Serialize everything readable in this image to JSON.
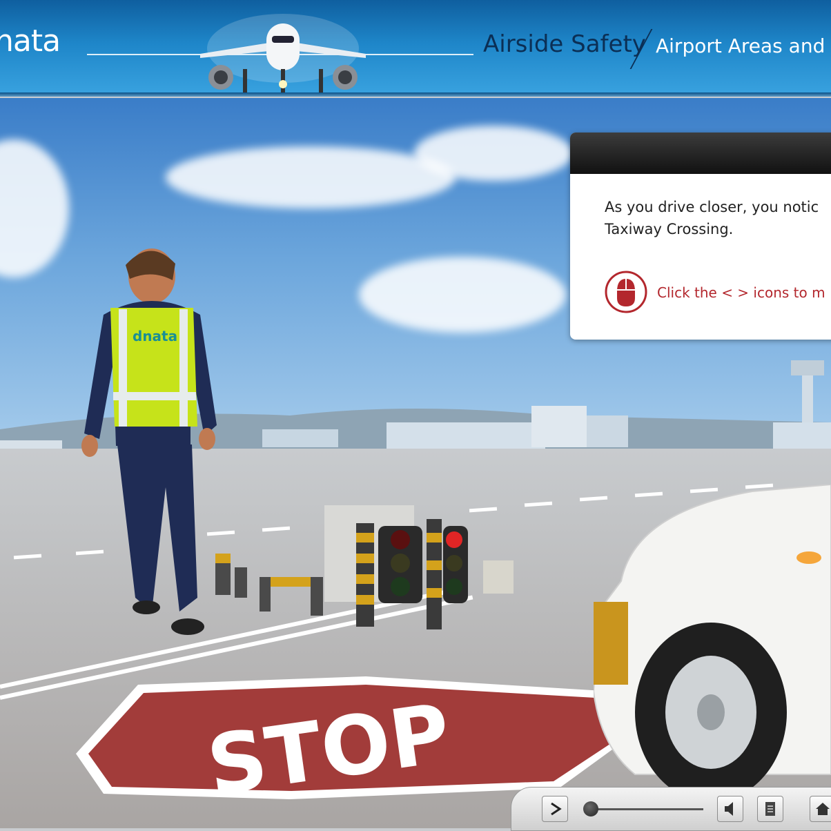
{
  "header": {
    "brand": "nata",
    "title": "Airside Safety",
    "subtitle": "Airport Areas and"
  },
  "scene": {
    "vest_logo": "dnata",
    "road_marking": "STOP"
  },
  "infobox": {
    "line1": "As you drive closer, you notic",
    "line2": "Taxiway Crossing.",
    "hint": "Click the < > icons to m"
  },
  "controls": {
    "play_icon": "play-icon",
    "volume_icon": "speaker-icon",
    "notes_icon": "document-icon",
    "home_icon": "home-icon"
  },
  "colors": {
    "header_blue": "#1e86c9",
    "title_navy": "#0b2f55",
    "hint_red": "#b3272d",
    "stop_red": "#a23c3a",
    "vest_yellow": "#c6e31a"
  }
}
